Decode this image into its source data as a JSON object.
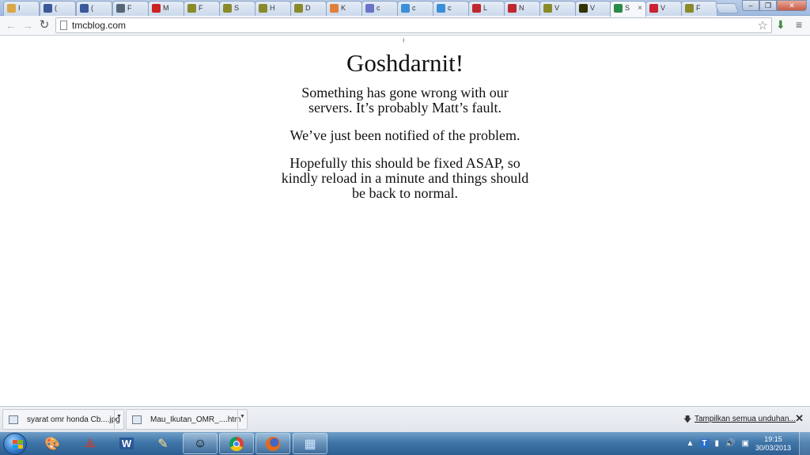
{
  "browser": {
    "tabs": [
      {
        "label": "I",
        "icon": "mail-icon",
        "color": "#d9a648"
      },
      {
        "label": "(",
        "icon": "facebook-icon",
        "color": "#3b5998"
      },
      {
        "label": "(",
        "icon": "facebook-icon",
        "color": "#3b5998"
      },
      {
        "label": "F",
        "icon": "page-icon",
        "color": "#556677"
      },
      {
        "label": "M",
        "icon": "red-circle-icon",
        "color": "#cc2222"
      },
      {
        "label": "F",
        "icon": "omr-icon",
        "color": "#8a8a2a"
      },
      {
        "label": "S",
        "icon": "omr-icon",
        "color": "#8a8a2a"
      },
      {
        "label": "H",
        "icon": "omr-icon",
        "color": "#8a8a2a"
      },
      {
        "label": "D",
        "icon": "omr-icon",
        "color": "#8a8a2a"
      },
      {
        "label": "K",
        "icon": "avatar-icon",
        "color": "#e0803a"
      },
      {
        "label": "c",
        "icon": "google-plus-icon",
        "color": "#6a74c8"
      },
      {
        "label": "c",
        "icon": "facebook-icon",
        "color": "#3b8fd8"
      },
      {
        "label": "c",
        "icon": "facebook-icon",
        "color": "#3b8fd8"
      },
      {
        "label": "L",
        "icon": "r-icon",
        "color": "#c0282e"
      },
      {
        "label": "N",
        "icon": "r-icon",
        "color": "#c0282e"
      },
      {
        "label": "V",
        "icon": "omr-icon",
        "color": "#8a8a2a"
      },
      {
        "label": "V",
        "icon": "omr-icon",
        "color": "#333300"
      },
      {
        "label": "S",
        "icon": "site-icon",
        "color": "#2a8a4a",
        "active": true
      },
      {
        "label": "V",
        "icon": "flag-icon",
        "color": "#cc2233"
      },
      {
        "label": "F",
        "icon": "omr-icon",
        "color": "#8a8a2a"
      }
    ],
    "active_tab_close": "×",
    "url": "tmcblog.com"
  },
  "page": {
    "title": "Goshdarnit!",
    "paragraph1": "Something has gone wrong with our servers. It’s probably Matt’s fault.",
    "paragraph2": "We’ve just been notified of the problem.",
    "paragraph3": "Hopefully this should be fixed ASAP, so kindly reload in a minute and things should be back to normal."
  },
  "downloads": {
    "items": [
      {
        "name": "syarat omr honda Cb....jpg"
      },
      {
        "name": "Mau_Ikutan_OMR_....htm"
      }
    ],
    "show_all": "Tampilkan semua unduhan...",
    "close": "✕"
  },
  "taskbar": {
    "time": "19:15",
    "date": "30/03/2013"
  }
}
